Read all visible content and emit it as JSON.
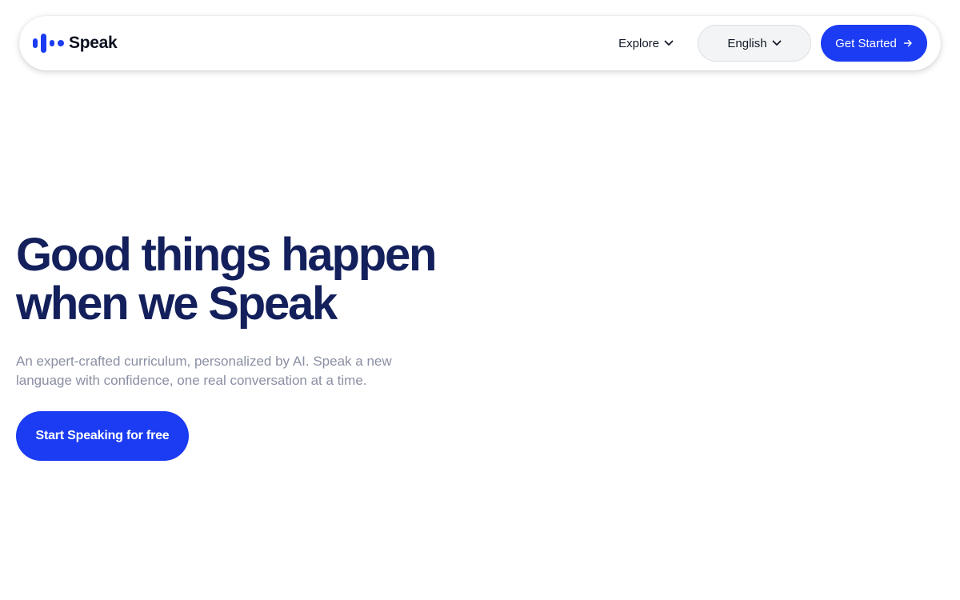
{
  "header": {
    "logo_text": "Speak",
    "explore_label": "Explore",
    "language_label": "English",
    "get_started_label": "Get Started"
  },
  "hero": {
    "title_line1": "Good things happen",
    "title_line2": "when we Speak",
    "subtitle": "An expert-crafted curriculum, personalized by AI. Speak a new language with confidence, one real conversation at a time.",
    "cta_label": "Start Speaking for free"
  },
  "icons": {
    "logo": "speak-logo-icon",
    "explore_chevron": "chevron-down-icon",
    "language_chevron": "chevron-down-icon",
    "get_started_arrow": "arrow-right-icon"
  },
  "colors": {
    "brand_blue": "#1b3cf2",
    "headline_navy": "#13205c",
    "subtitle_gray": "#8a8fa3",
    "language_button_bg": "#f3f4f5"
  }
}
